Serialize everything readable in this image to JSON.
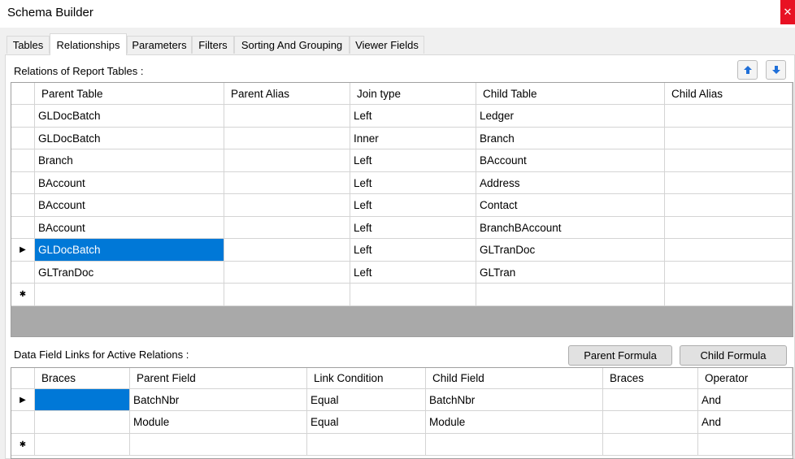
{
  "window": {
    "title": "Schema Builder",
    "close_glyph": "✕"
  },
  "tabs": [
    {
      "label": "Tables"
    },
    {
      "label": "Relationships"
    },
    {
      "label": "Parameters"
    },
    {
      "label": "Filters"
    },
    {
      "label": "Sorting And Grouping"
    },
    {
      "label": "Viewer Fields"
    }
  ],
  "active_tab": "Relationships",
  "relations": {
    "label": "Relations of Report Tables :",
    "columns": [
      "Parent Table",
      "Parent Alias",
      "Join type",
      "Child Table",
      "Child Alias"
    ],
    "rows": [
      {
        "parent_table": "GLDocBatch",
        "parent_alias": "",
        "join_type": "Left",
        "child_table": "Ledger",
        "child_alias": ""
      },
      {
        "parent_table": "GLDocBatch",
        "parent_alias": "",
        "join_type": "Inner",
        "child_table": "Branch",
        "child_alias": ""
      },
      {
        "parent_table": "Branch",
        "parent_alias": "",
        "join_type": "Left",
        "child_table": "BAccount",
        "child_alias": ""
      },
      {
        "parent_table": "BAccount",
        "parent_alias": "",
        "join_type": "Left",
        "child_table": "Address",
        "child_alias": ""
      },
      {
        "parent_table": "BAccount",
        "parent_alias": "",
        "join_type": "Left",
        "child_table": "Contact",
        "child_alias": ""
      },
      {
        "parent_table": "BAccount",
        "parent_alias": "",
        "join_type": "Left",
        "child_table": "BranchBAccount",
        "child_alias": ""
      },
      {
        "parent_table": "GLDocBatch",
        "parent_alias": "",
        "join_type": "Left",
        "child_table": "GLTranDoc",
        "child_alias": ""
      },
      {
        "parent_table": "GLTranDoc",
        "parent_alias": "",
        "join_type": "Left",
        "child_table": "GLTran",
        "child_alias": ""
      }
    ],
    "current_row_marker": "▶",
    "new_row_marker": "✱"
  },
  "field_links": {
    "label": "Data Field Links for Active Relations :",
    "parent_formula_label": "Parent Formula",
    "child_formula_label": "Child Formula",
    "columns": [
      "Braces",
      "Parent Field",
      "Link Condition",
      "Child Field",
      "Braces",
      "Operator"
    ],
    "rows": [
      {
        "braces_open": "",
        "parent_field": "BatchNbr",
        "link_condition": "Equal",
        "child_field": "BatchNbr",
        "braces_close": "",
        "operator": "And"
      },
      {
        "braces_open": "",
        "parent_field": "Module",
        "link_condition": "Equal",
        "child_field": "Module",
        "braces_close": "",
        "operator": "And"
      }
    ],
    "current_row_marker": "▶",
    "new_row_marker": "✱"
  },
  "icons": {
    "move_up": "arrow-up-icon",
    "move_down": "arrow-down-icon",
    "accent": "#0078d7"
  }
}
